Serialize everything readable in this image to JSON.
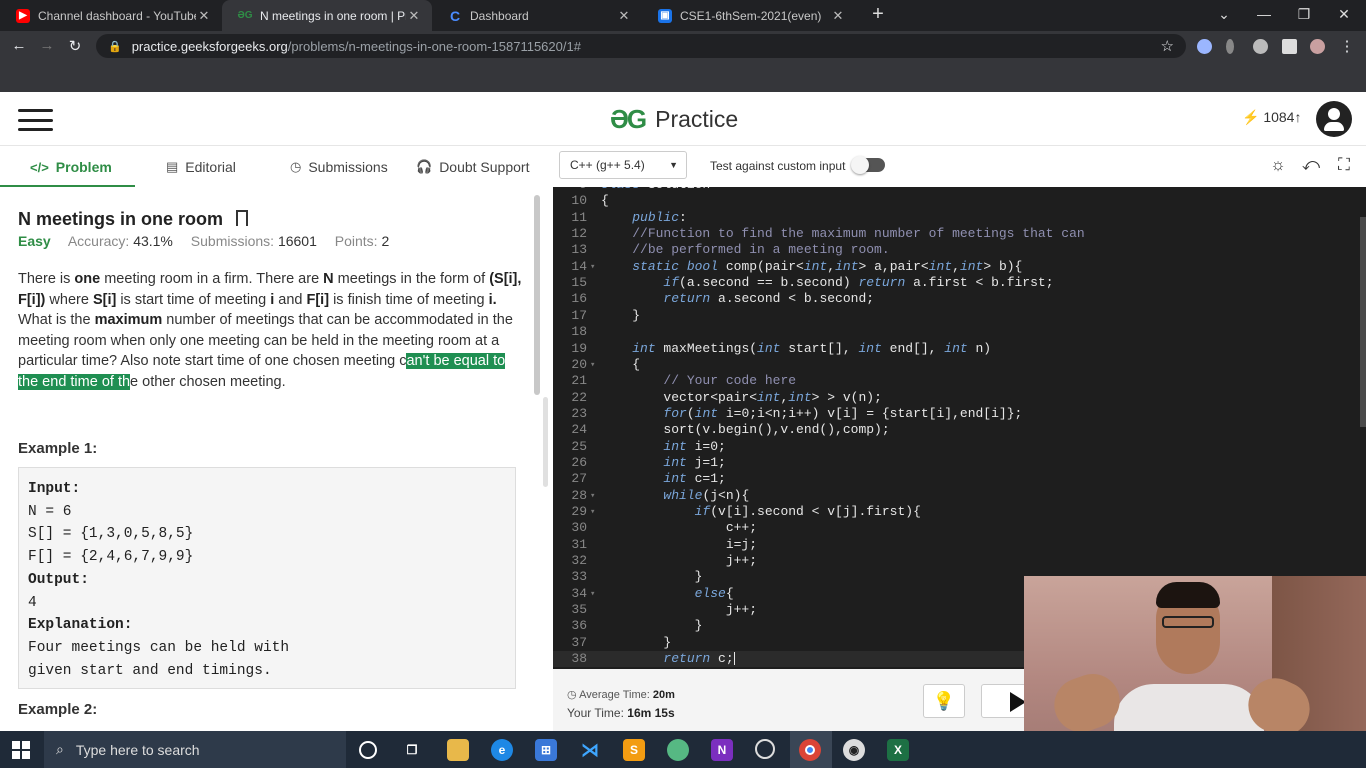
{
  "browser": {
    "tabs": [
      {
        "title": "Channel dashboard - YouTube St",
        "icon": "youtube-icon"
      },
      {
        "title": "N meetings in one room | Practic",
        "icon": "gfg-icon"
      },
      {
        "title": "Dashboard",
        "icon": "c-icon"
      },
      {
        "title": "CSE1-6thSem-2021(even)",
        "icon": "classroom-icon"
      }
    ],
    "url_host": "practice.geeksforgeeks.org",
    "url_path": "/problems/n-meetings-in-one-room-1587115620/1#"
  },
  "header": {
    "logo_mark": "ƏG",
    "logo_text": "Practice",
    "streak": "1084",
    "streak_arrow": "↑"
  },
  "problem_tabs": [
    {
      "label": "Problem",
      "icon": "</>"
    },
    {
      "label": "Editorial",
      "icon": "▤"
    },
    {
      "label": "Submissions",
      "icon": "◷"
    },
    {
      "label": "Doubt Support",
      "icon": "🎧"
    }
  ],
  "editor_toolbar": {
    "language": "C++ (g++ 5.4)",
    "custom_input_label": "Test against custom input"
  },
  "problem": {
    "title": "N meetings in one room",
    "difficulty": "Easy",
    "accuracy_label": "Accuracy:",
    "accuracy": "43.1%",
    "submissions_label": "Submissions:",
    "submissions": "16601",
    "points_label": "Points:",
    "points": "2",
    "desc": {
      "p1a": "There is ",
      "p1b": "one",
      "p1c": " meeting room in a firm. There are ",
      "p1d": "N",
      "p1e": " meetings in the form of ",
      "p1f": "(S[i], F[i])",
      "p1g": " where ",
      "p1h": "S[i]",
      "p1i": " is start time of meeting ",
      "p1j": "i",
      "p1k": " and ",
      "p1l": "F[i]",
      "p1m": " is finish time of meeting ",
      "p1n": "i.",
      "p2a": "What is the ",
      "p2b": "maximum",
      "p2c": " number of meetings that can be accommodated in the meeting room when only one meeting can be held in the meeting room at a particular time? Also note start time of one chosen meeting c",
      "p2d": "an't be equal to the end time of th",
      "p2e": "e other chosen meeting."
    },
    "example1_title": "Example 1:",
    "example1_lines": [
      {
        "key": "Input:",
        "text": ""
      },
      {
        "key": "",
        "text": "N = 6"
      },
      {
        "key": "",
        "text": "S[] = {1,3,0,5,8,5}"
      },
      {
        "key": "",
        "text": "F[] = {2,4,6,7,9,9}"
      },
      {
        "key": "Output:",
        "text": ""
      },
      {
        "key": "",
        "text": "4"
      },
      {
        "key": "Explanation:",
        "text": ""
      },
      {
        "key": "",
        "text": "Four meetings can be held with"
      },
      {
        "key": "",
        "text": "given start and end timings."
      }
    ],
    "example2_title": "Example 2:"
  },
  "code": {
    "lines": [
      {
        "n": "9",
        "fold": "",
        "html": "<span class=\"kw\">class</span> Solution"
      },
      {
        "n": "10",
        "fold": "",
        "html": "{"
      },
      {
        "n": "11",
        "fold": "",
        "html": "    <span class=\"kw\">public</span>:"
      },
      {
        "n": "12",
        "fold": "",
        "html": "    <span class=\"cmt\">//Function to find the maximum number of meetings that can</span>"
      },
      {
        "n": "13",
        "fold": "",
        "html": "    <span class=\"cmt\">//be performed in a meeting room.</span>"
      },
      {
        "n": "14",
        "fold": "▾",
        "html": "    <span class=\"kw\">static bool</span> comp(pair&lt;<span class=\"kw\">int</span>,<span class=\"kw\">int</span>&gt; a,pair&lt;<span class=\"kw\">int</span>,<span class=\"kw\">int</span>&gt; b){"
      },
      {
        "n": "15",
        "fold": "",
        "html": "        <span class=\"kw\">if</span>(a.second == b.second) <span class=\"kw\">return</span> a.first &lt; b.first;"
      },
      {
        "n": "16",
        "fold": "",
        "html": "        <span class=\"kw\">return</span> a.second &lt; b.second;"
      },
      {
        "n": "17",
        "fold": "",
        "html": "    }"
      },
      {
        "n": "18",
        "fold": "",
        "html": ""
      },
      {
        "n": "19",
        "fold": "",
        "html": "    <span class=\"kw\">int</span> maxMeetings(<span class=\"kw\">int</span> start[], <span class=\"kw\">int</span> end[], <span class=\"kw\">int</span> n)"
      },
      {
        "n": "20",
        "fold": "▾",
        "html": "    {"
      },
      {
        "n": "21",
        "fold": "",
        "html": "        <span class=\"cmt\">// Your code here</span>"
      },
      {
        "n": "22",
        "fold": "",
        "html": "        vector&lt;pair&lt;<span class=\"kw\">int</span>,<span class=\"kw\">int</span>&gt; &gt; v(n);"
      },
      {
        "n": "23",
        "fold": "",
        "html": "        <span class=\"kw\">for</span>(<span class=\"kw\">int</span> i=0;i&lt;n;i++) v[i] = {start[i],end[i]};"
      },
      {
        "n": "24",
        "fold": "",
        "html": "        sort(v.begin(),v.end(),comp);"
      },
      {
        "n": "25",
        "fold": "",
        "html": "        <span class=\"kw\">int</span> i=0;"
      },
      {
        "n": "26",
        "fold": "",
        "html": "        <span class=\"kw\">int</span> j=1;"
      },
      {
        "n": "27",
        "fold": "",
        "html": "        <span class=\"kw\">int</span> c=1;"
      },
      {
        "n": "28",
        "fold": "▾",
        "html": "        <span class=\"kw\">while</span>(j&lt;n){"
      },
      {
        "n": "29",
        "fold": "▾",
        "html": "            <span class=\"kw\">if</span>(v[i].second &lt; v[j].first){"
      },
      {
        "n": "30",
        "fold": "",
        "html": "                c++;"
      },
      {
        "n": "31",
        "fold": "",
        "html": "                i=j;"
      },
      {
        "n": "32",
        "fold": "",
        "html": "                j++;"
      },
      {
        "n": "33",
        "fold": "",
        "html": "            }"
      },
      {
        "n": "34",
        "fold": "▾",
        "html": "            <span class=\"kw\">else</span>{"
      },
      {
        "n": "35",
        "fold": "",
        "html": "                j++;"
      },
      {
        "n": "36",
        "fold": "",
        "html": "            }"
      },
      {
        "n": "37",
        "fold": "",
        "html": "        }"
      },
      {
        "n": "38",
        "fold": "",
        "html": "        <span class=\"kw\">return</span> c;<span class=\"caret\"></span>"
      }
    ]
  },
  "footer": {
    "avg_label": "Average Time:",
    "avg": "20m",
    "your_label": "Your Time:",
    "your": "16m 15s"
  },
  "taskbar": {
    "search_placeholder": "Type here to search"
  },
  "colors": {
    "gfg_green": "#2f8d46",
    "highlight": "#1f8f52",
    "editor_bg": "#1e1e1e",
    "taskbar_bg": "#1f2a38"
  }
}
